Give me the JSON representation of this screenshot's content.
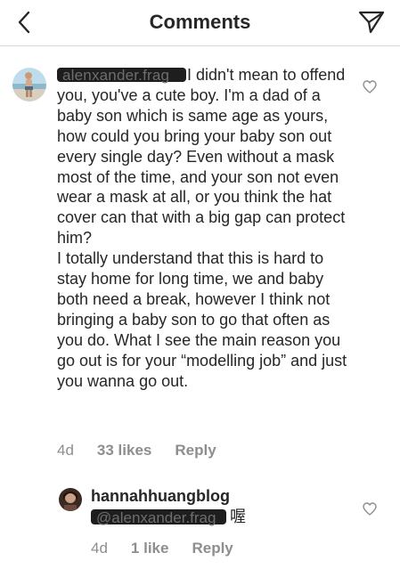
{
  "header": {
    "title": "Comments",
    "back_icon": "chevron-left-icon",
    "send_icon": "paper-plane-icon"
  },
  "comments": [
    {
      "username": "alenxander.frag",
      "text": "I didn't mean to offend you, you've a cute boy. I'm a dad of a baby son which is same age as yours, how could you bring your baby son out every single day? Even without a mask most of the time, and your son not even wear a mask at all, or you think the hat cover can that with a big gap can protect him?",
      "text2": "I totally understand that this is hard to stay home for long time, we and baby both need a break, however I think not bringing a baby son to go that often as you do. What I see the main reason you go out is for your “modelling job” and just you wanna go out.",
      "time": "4d",
      "likes": "33 likes",
      "reply": "Reply",
      "like_icon": "heart-outline-icon"
    },
    {
      "username": "hannahhuangblog",
      "mention": "@alenxander.frag",
      "text": "喔",
      "time": "4d",
      "likes": "1 like",
      "reply": "Reply",
      "like_icon": "heart-outline-icon"
    }
  ],
  "colors": {
    "text": "#262626",
    "secondary": "#8e8e8e",
    "divider": "#dbdbdb",
    "redaction": "#1e1e1e"
  }
}
